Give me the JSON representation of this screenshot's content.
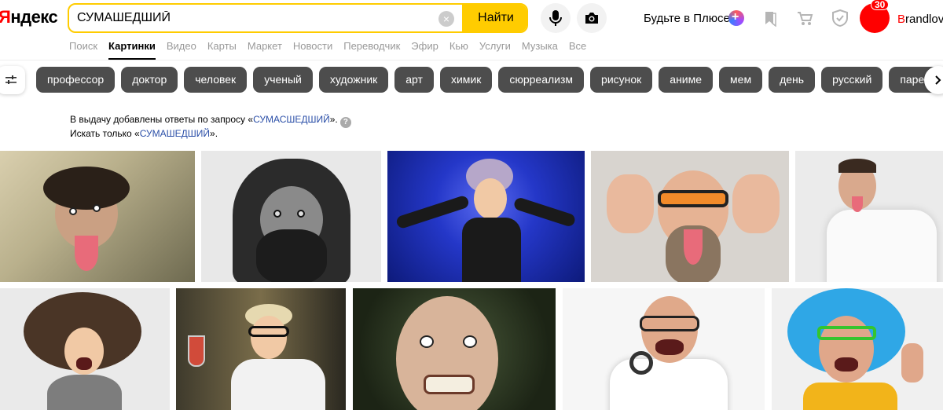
{
  "header": {
    "logo_first": "Я",
    "logo_rest": "ндекс",
    "search_value": "СУМАШЕДШИЙ",
    "find_label": "Найти",
    "plus_label": "Будьте в Плюсе",
    "notifications_count": "30",
    "username_first": "B",
    "username_rest": "randlovv"
  },
  "nav": {
    "tabs": [
      "Поиск",
      "Картинки",
      "Видео",
      "Карты",
      "Маркет",
      "Новости",
      "Переводчик",
      "Эфир",
      "Кью",
      "Услуги",
      "Музыка",
      "Все"
    ],
    "active": "Картинки"
  },
  "chips": [
    "профессор",
    "доктор",
    "человек",
    "ученый",
    "художник",
    "арт",
    "химик",
    "сюрреализм",
    "рисунок",
    "аниме",
    "мем",
    "день",
    "русский",
    "парень"
  ],
  "notice": {
    "line1_prefix": "В выдачу добавлены ответы по запросу «",
    "line1_query": "СУМАСШЕДШИЙ",
    "line1_suffix": "».",
    "line2_prefix": "Искать только «",
    "line2_query": "СУМАШЕДШИЙ",
    "line2_suffix": "»."
  },
  "icons": {
    "microphone": "microphone-icon",
    "camera": "camera-icon",
    "bookmark": "bookmark-icon",
    "cart": "cart-icon",
    "shield": "shield-icon",
    "filter": "filter-icon",
    "next": "chevron-right-icon",
    "help": "help-icon"
  },
  "colors": {
    "accent": "#ffcc00",
    "chip_bg": "#4d4d4d",
    "link": "#2b4fa8",
    "avatar": "#ff0000"
  }
}
